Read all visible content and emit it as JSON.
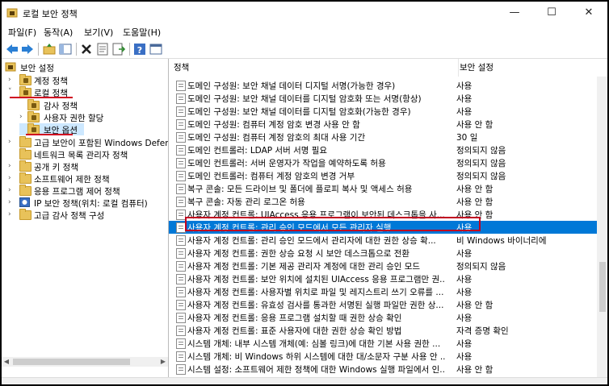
{
  "window": {
    "title": "로컬 보안 정책",
    "minimize": "—",
    "maximize": "☐",
    "close": "✕"
  },
  "menu": [
    "파일(F)",
    "동작(A)",
    "보기(V)",
    "도움말(H)"
  ],
  "toolbar": {
    "icons": [
      "back-arrow-icon",
      "forward-arrow-icon",
      "up-folder-icon",
      "show-hide-tree-icon",
      "delete-icon",
      "properties-icon",
      "export-list-icon",
      "help-icon",
      "console-icon"
    ]
  },
  "tree": {
    "root": "보안 설정",
    "account_policy": "계정 정책",
    "local_policy": "로컬 정책",
    "audit_policy": "감사 정책",
    "user_rights": "사용자 권한 할당",
    "security_options": "보안 옵션",
    "firewall": "고급 보안이 포함된 Windows Defender",
    "network_list": "네트워크 목록 관리자 정책",
    "public_key": "공개 키 정책",
    "software_restriction": "소프트웨어 제한 정책",
    "app_control": "응용 프로그램 제어 정책",
    "ipsec": "IP 보안 정책(위치: 로컬 컴퓨터)",
    "advanced_audit": "고급 감사 정책 구성"
  },
  "columns": {
    "policy": "정책",
    "setting": "보안 설정"
  },
  "rows": [
    {
      "policy": "도메인 구성원: 보안 채널 데이터 디지털 서명(가능한 경우)",
      "setting": "사용"
    },
    {
      "policy": "도메인 구성원: 보안 채널 데이터를 디지털 암호화 또는 서명(항상)",
      "setting": "사용"
    },
    {
      "policy": "도메인 구성원: 보안 채널 데이터를 디지털 암호화(가능한 경우)",
      "setting": "사용"
    },
    {
      "policy": "도메인 구성원: 컴퓨터 계정 암호 변경 사용 안 함",
      "setting": "사용 안 함"
    },
    {
      "policy": "도메인 구성원: 컴퓨터 계정 암호의 최대 사용 기간",
      "setting": "30 일"
    },
    {
      "policy": "도메인 컨트롤러: LDAP 서버 서명 필요",
      "setting": "정의되지 않음"
    },
    {
      "policy": "도메인 컨트롤러: 서버 운영자가 작업을 예약하도록 허용",
      "setting": "정의되지 않음"
    },
    {
      "policy": "도메인 컨트롤러: 컴퓨터 계정 암호의 변경 거부",
      "setting": "정의되지 않음"
    },
    {
      "policy": "복구 콘솔: 모든 드라이브 및 폴더에 플로피 복사 및 액세스 허용",
      "setting": "사용 안 함"
    },
    {
      "policy": "복구 콘솔: 자동 관리 로그온 허용",
      "setting": "사용 안 함"
    },
    {
      "policy": "사용자 계정 컨트롤: UIAccess 응용 프로그램이 보안된 데스크톱을 사...",
      "setting": "사용 안 함"
    },
    {
      "policy": "사용자 계정 컨트롤: 관리 승인 모드에서 모든 관리자 실행",
      "setting": "사용"
    },
    {
      "policy": "사용자 계정 컨트롤: 관리 승인 모드에서 관리자에 대한 권한 상승 확...",
      "setting": "비 Windows 바이너리에"
    },
    {
      "policy": "사용자 계정 컨트롤: 권한 상승 요청 시 보안 데스크톱으로 전환",
      "setting": "사용"
    },
    {
      "policy": "사용자 계정 컨트롤: 기본 제공 관리자 계정에 대한 관리 승인 모드",
      "setting": "정의되지 않음"
    },
    {
      "policy": "사용자 계정 컨트롤: 보안 위치에 설치된 UIAccess 응용 프로그램만 권...",
      "setting": "사용"
    },
    {
      "policy": "사용자 계정 컨트롤: 사용자별 위치로 파일 및 레지스트리 쓰기 오류를 ...",
      "setting": "사용"
    },
    {
      "policy": "사용자 계정 컨트롤: 유효성 검사를 통과한 서명된 실행 파일만 권한 상...",
      "setting": "사용 안 함"
    },
    {
      "policy": "사용자 계정 컨트롤: 응용 프로그램 설치할 때 권한 상승 확인",
      "setting": "사용"
    },
    {
      "policy": "사용자 계정 컨트롤: 표준 사용자에 대한 권한 상승 확인 방법",
      "setting": "자격 증명 확인"
    },
    {
      "policy": "시스템 개체: 내부 시스템 개체(예: 심볼 링크)에 대한 기본 사용 권한 ...",
      "setting": "사용"
    },
    {
      "policy": "시스템 개체: 비 Windows 하위 시스템에 대한 대/소문자 구분 사용 안 ...",
      "setting": "사용"
    },
    {
      "policy": "시스템 설정: 소프트웨어 제한 정책에 대한 Windows 실행 파일에서 인...",
      "setting": "사용 안 함"
    }
  ],
  "colors": {
    "selection": "#0078d7",
    "highlight_box": "#c00020"
  }
}
